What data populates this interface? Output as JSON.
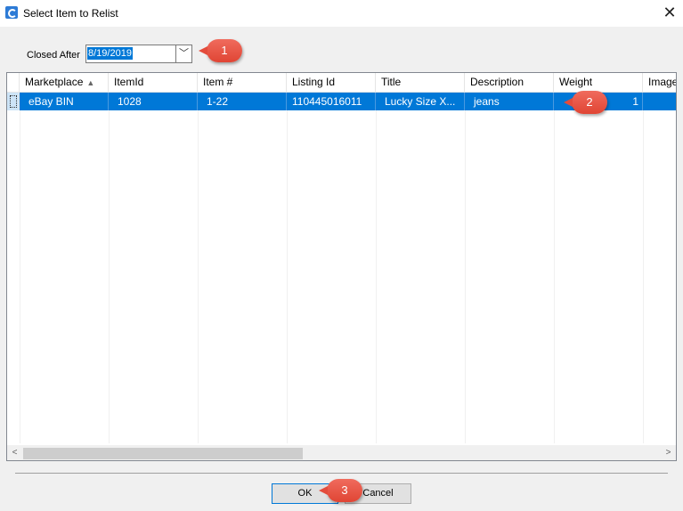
{
  "window": {
    "title": "Select Item to Relist",
    "close_glyph": "✕"
  },
  "filter": {
    "label": "Closed After",
    "date_value": "8/19/2019",
    "dropdown_glyph": "﹀"
  },
  "grid": {
    "columns": [
      "Marketplace",
      "ItemId",
      "Item #",
      "Listing Id",
      "Title",
      "Description",
      "Weight",
      "Image"
    ],
    "sort_glyph": "▲",
    "rows": [
      [
        "eBay BIN",
        "1028",
        "1-22",
        "110445016011",
        "Lucky Size X...",
        "jeans",
        "1",
        ""
      ]
    ]
  },
  "scrollbar": {
    "left_glyph": "<",
    "right_glyph": ">"
  },
  "buttons": {
    "ok": "OK",
    "cancel": "Cancel"
  },
  "callouts": {
    "one": "1",
    "two": "2",
    "three": "3"
  },
  "colors": {
    "selection": "#0078d7",
    "callout": "#e04534"
  }
}
